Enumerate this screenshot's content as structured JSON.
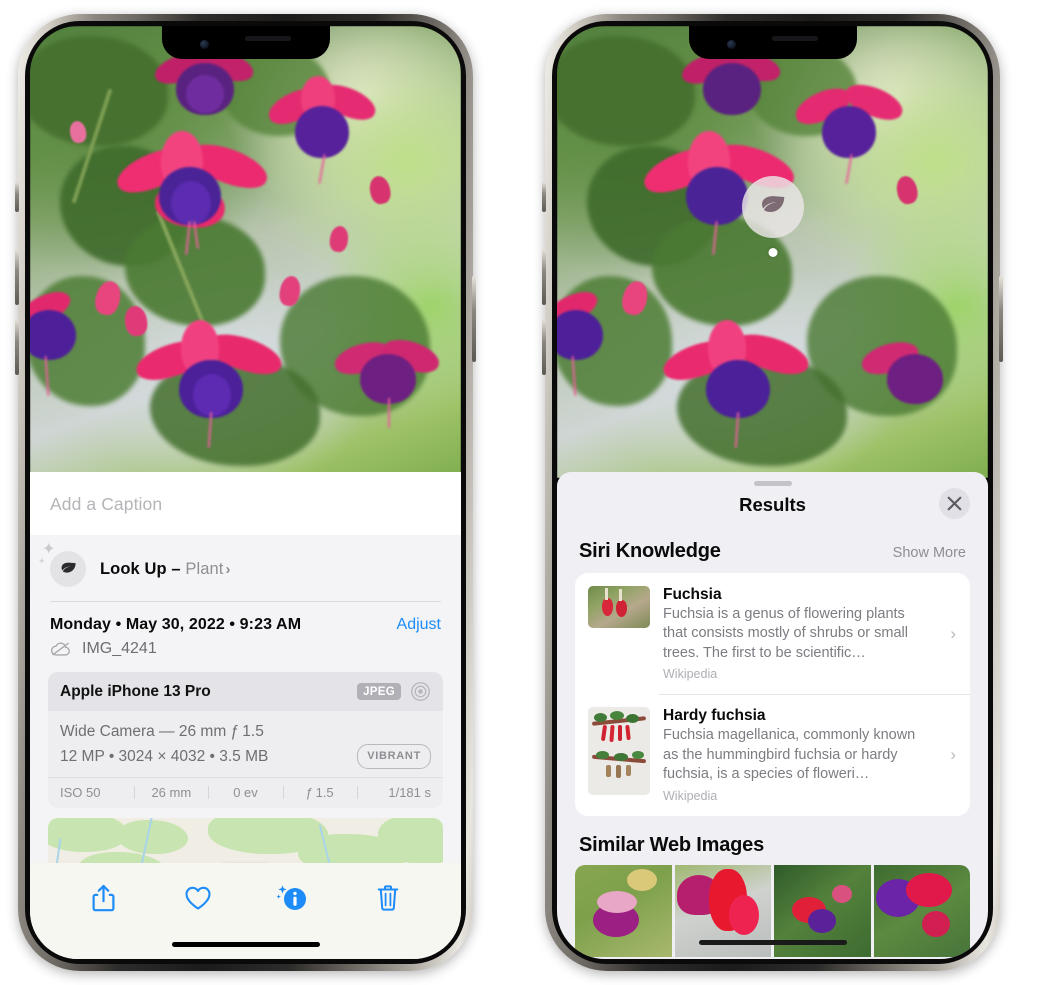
{
  "left_phone": {
    "caption": {
      "placeholder": "Add a Caption",
      "value": ""
    },
    "lookup": {
      "label": "Look Up – ",
      "subject": "Plant",
      "icon": "leaf-icon",
      "chevron": "›"
    },
    "info": {
      "date": "Monday • May 30, 2022 • 9:23 AM",
      "adjust_label": "Adjust",
      "filename": "IMG_4241",
      "cloud_icon": "cloud-slash-icon"
    },
    "camera": {
      "model": "Apple iPhone 13 Pro",
      "format_badge": "JPEG",
      "aperture_icon": "aperture-icon",
      "lens_line": "Wide Camera — 26 mm ƒ 1.5",
      "specs_line": "12 MP • 3024 × 4032 • 3.5 MB",
      "style_badge": "VIBRANT",
      "exif": [
        "ISO 50",
        "26 mm",
        "0 ev",
        "ƒ 1.5",
        "1/181 s"
      ]
    },
    "toolbar": [
      {
        "name": "share-button",
        "icon": "share-icon",
        "active": false
      },
      {
        "name": "favorite-button",
        "icon": "heart-icon",
        "active": false
      },
      {
        "name": "info-button",
        "icon": "info-sparkle-icon",
        "active": true
      },
      {
        "name": "delete-button",
        "icon": "trash-icon",
        "active": false
      }
    ]
  },
  "right_phone": {
    "lens_badge_icon": "leaf-icon",
    "sheet": {
      "title": "Results",
      "close_icon": "close-icon",
      "grabber": "drag-handle"
    },
    "siri": {
      "section_title": "Siri Knowledge",
      "show_more": "Show More",
      "cards": [
        {
          "title": "Fuchsia",
          "description": "Fuchsia is a genus of flowering plants that consists mostly of shrubs or small trees. The first to be scientific…",
          "source": "Wikipedia",
          "chevron": "›"
        },
        {
          "title": "Hardy fuchsia",
          "description": "Fuchsia magellanica, commonly known as the hummingbird fuchsia or hardy fuchsia, is a species of floweri…",
          "source": "Wikipedia",
          "chevron": "›"
        }
      ]
    },
    "web": {
      "section_title": "Similar Web Images",
      "tiles": [
        "web-image-1",
        "web-image-2",
        "web-image-3",
        "web-image-4"
      ]
    }
  },
  "colors": {
    "accent_blue": "#1d8cf8",
    "sheet_bg": "#f0eff4",
    "card_bg": "#ffffff",
    "secondary_text": "#8e8e93"
  }
}
